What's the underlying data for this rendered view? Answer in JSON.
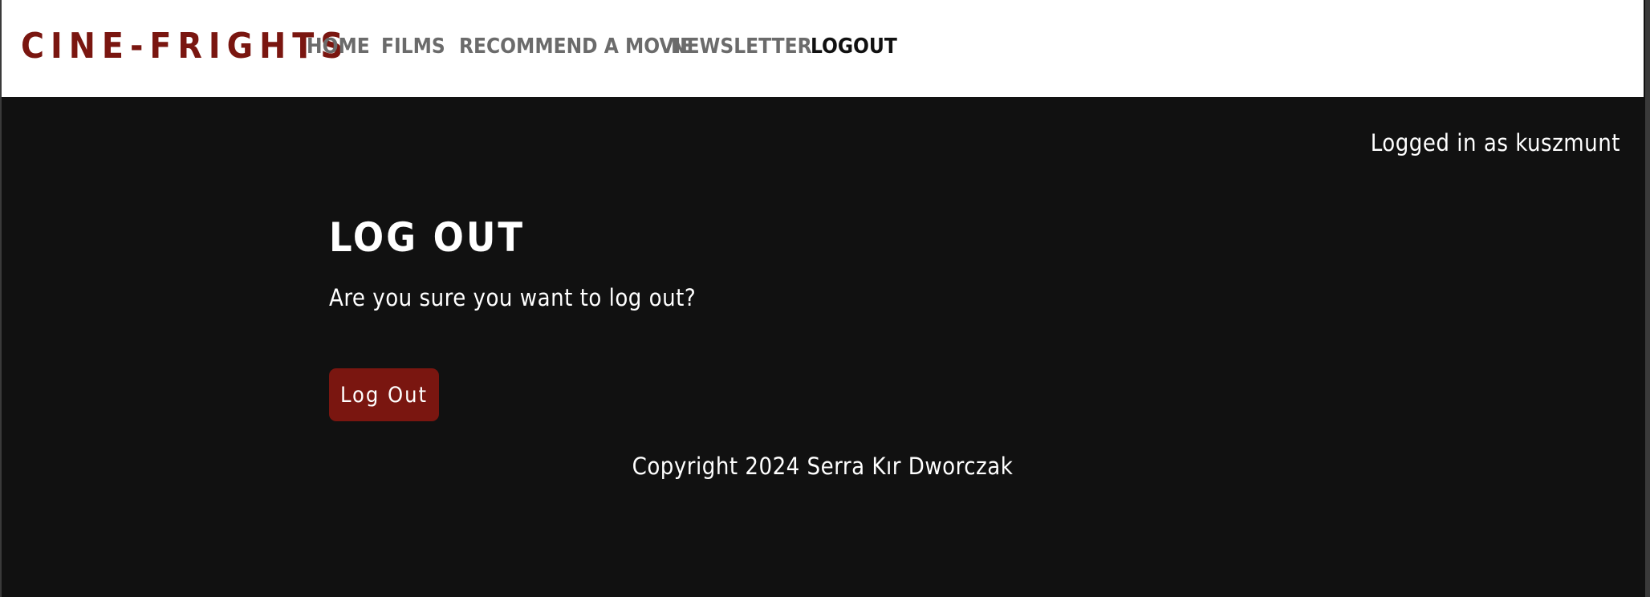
{
  "navbar": {
    "brand": "CINE-FRIGHTS",
    "items": [
      {
        "label": "HOME",
        "active": false
      },
      {
        "label": "FILMS",
        "active": false
      },
      {
        "label": "RECOMMEND A MOVIE",
        "active": false
      },
      {
        "label": "NEWSLETTER",
        "active": false
      },
      {
        "label": "LOGOUT",
        "active": true
      }
    ]
  },
  "status": {
    "logged_in_text": "Logged in as kuszmunt"
  },
  "main": {
    "heading": "LOG OUT",
    "question": "Are you sure you want to log out?",
    "button_label": "Log Out"
  },
  "footer": {
    "copyright": "Copyright 2024 Serra Kır Dworczak"
  },
  "colors": {
    "brand": "#7a1610",
    "background": "#111111",
    "nav_text": "#6b6b6b",
    "nav_active": "#111111",
    "button": "#7a1610"
  }
}
